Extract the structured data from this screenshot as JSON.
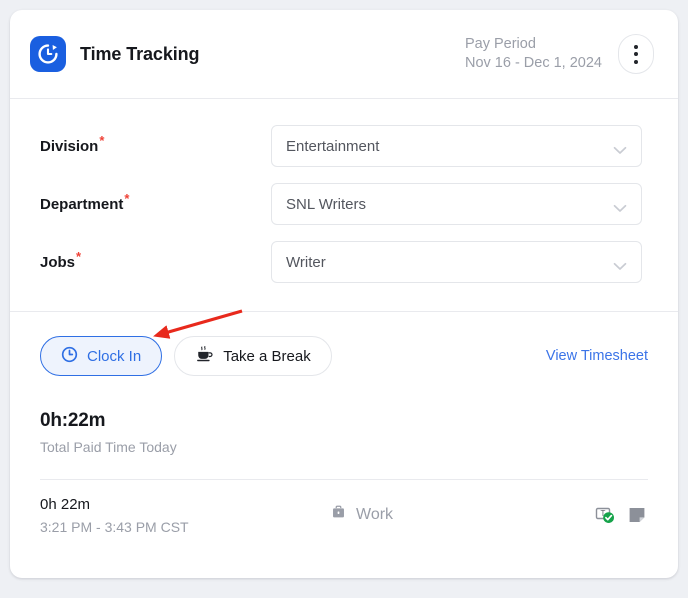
{
  "header": {
    "app_title": "Time Tracking",
    "brand_icon": "clock-timer-icon",
    "brand_color": "#1a5fe0",
    "pay_period_label": "Pay Period",
    "pay_period_range": "Nov 16 - Dec 1, 2024",
    "menu_icon": "kebab-menu-icon"
  },
  "form": {
    "fields": [
      {
        "label": "Division",
        "required_marker": "*",
        "value": "Entertainment",
        "chevron": "chevron-down-icon"
      },
      {
        "label": "Department",
        "required_marker": "*",
        "value": "SNL Writers",
        "chevron": "chevron-down-icon"
      },
      {
        "label": "Jobs",
        "required_marker": "*",
        "value": "Writer",
        "chevron": "chevron-down-icon"
      }
    ]
  },
  "actions": {
    "clock_in_label": "Clock In",
    "clock_in_icon": "clock-icon",
    "clock_in_color": "#2f6fe4",
    "take_break_label": "Take a Break",
    "take_break_icon": "coffee-cup-icon",
    "view_timesheet_label": "View Timesheet",
    "view_timesheet_color": "#3b74e8",
    "annotation": {
      "shape": "arrow",
      "color": "#e8291c",
      "points_to": "clock-in-button"
    }
  },
  "summary": {
    "total": "0h:22m",
    "caption": "Total Paid Time Today"
  },
  "entries": [
    {
      "duration": "0h 22m",
      "time_range": "3:21 PM - 3:43 PM CST",
      "type_label": "Work",
      "type_icon": "briefcase-icon",
      "status_icon": "timecard-approved-icon",
      "status_color": "#16a34a",
      "note_icon": "note-icon"
    }
  ]
}
